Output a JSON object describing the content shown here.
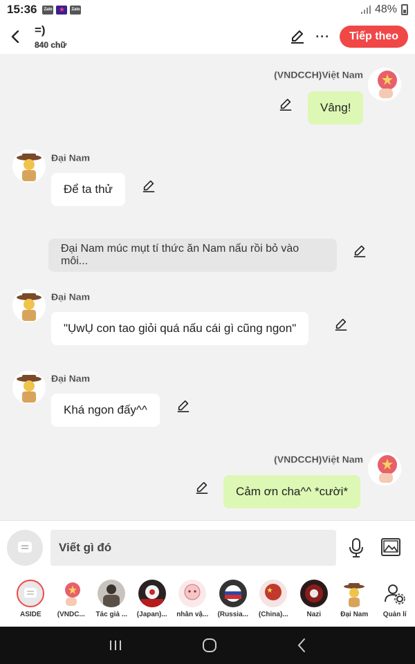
{
  "status": {
    "time": "15:36",
    "battery": "48%",
    "app_badges": [
      {
        "label": "Zalo",
        "style": "gray"
      },
      {
        "label": "★",
        "style": "purple"
      },
      {
        "label": "Zalo",
        "style": "gray"
      }
    ]
  },
  "header": {
    "title": "=)",
    "subtitle": "840 chữ",
    "next_label": "Tiếp theo",
    "more_label": "···"
  },
  "messages": [
    {
      "kind": "right",
      "name": "(VNDCCH)Việt Nam",
      "text": "Vâng!"
    },
    {
      "kind": "left",
      "name": "Đại Nam",
      "text": "Để ta thử"
    },
    {
      "kind": "narration",
      "text": "Đại Nam múc mụt tí thức ăn Nam nấu rồi bỏ vào môi..."
    },
    {
      "kind": "left",
      "name": "Đại Nam",
      "text": "\"ỤwỤ con tao giỏi quá nấu cái gì cũng ngon\""
    },
    {
      "kind": "left",
      "name": "Đại Nam",
      "text": "Khá ngon đấy^^"
    },
    {
      "kind": "right",
      "name": "(VNDCCH)Việt Nam",
      "text": "Cảm ơn cha^^ *cười*"
    }
  ],
  "input": {
    "placeholder": "Viết gì đó"
  },
  "characters": [
    {
      "label": "ASIDE",
      "icon": "aside-icon"
    },
    {
      "label": "(VNDC...",
      "icon": "avatar-vietnam"
    },
    {
      "label": "Tác giả ...",
      "icon": "avatar-author"
    },
    {
      "label": "(Japan)...",
      "icon": "avatar-japan"
    },
    {
      "label": "nhân vậ...",
      "icon": "avatar-character"
    },
    {
      "label": "(Russia...",
      "icon": "avatar-russia"
    },
    {
      "label": "(China)...",
      "icon": "avatar-china"
    },
    {
      "label": "Nazi",
      "icon": "avatar-nazi"
    },
    {
      "label": "Đại Nam",
      "icon": "avatar-dainam"
    },
    {
      "label": "Quản lí",
      "icon": "manage-icon"
    }
  ],
  "colors": {
    "accent": "#f04747",
    "bubble_green": "#dcf8b4",
    "bubble_white": "#ffffff",
    "narration": "#e6e6e6"
  }
}
